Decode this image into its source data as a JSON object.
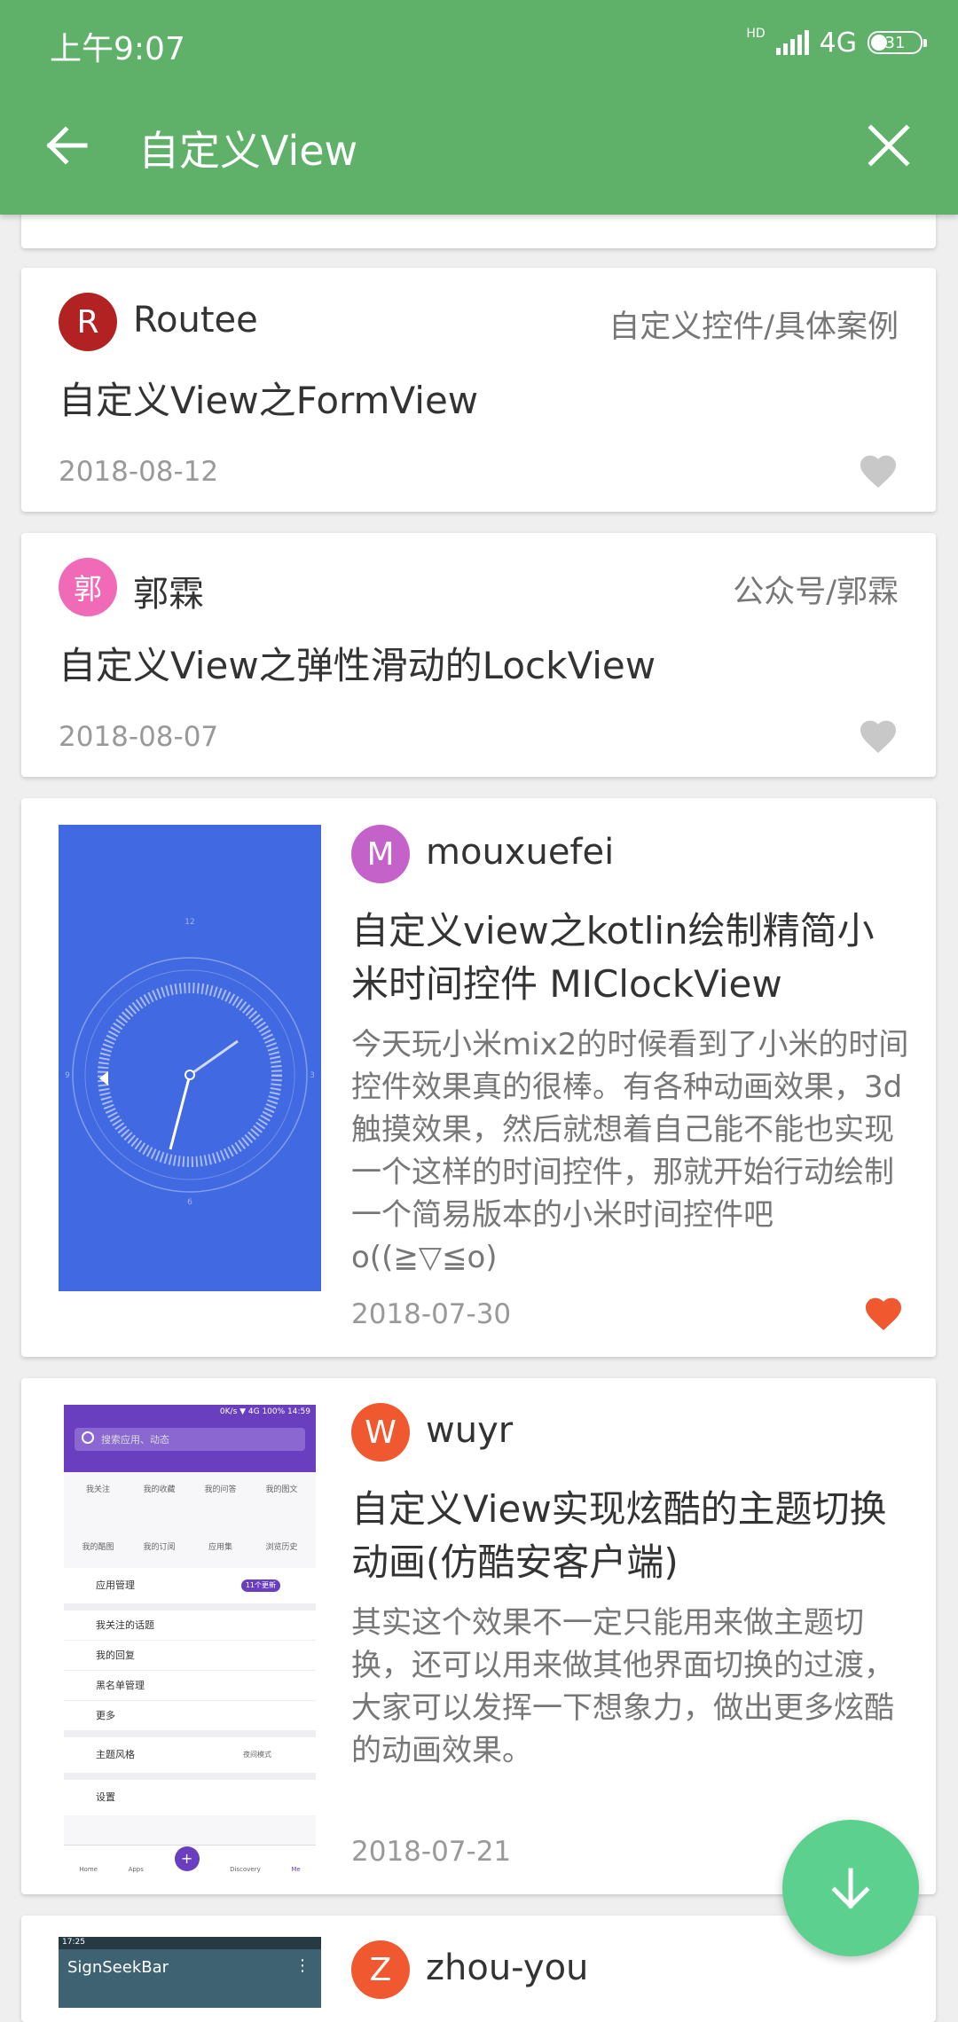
{
  "status_bar": {
    "time": "上午9:07",
    "hd": "HD",
    "network": "4G",
    "battery": "31"
  },
  "header": {
    "title": "自定义View"
  },
  "articles": [
    {
      "avatar_letter": "R",
      "avatar_color": "#b22222",
      "author": "Routee",
      "category": "自定义控件/具体案例",
      "title": "自定义View之FormView",
      "date": "2018-08-12",
      "liked": false
    },
    {
      "avatar_letter": "郭",
      "avatar_color": "#f06ab8",
      "author": "郭霖",
      "category": "公众号/郭霖",
      "title": "自定义View之弹性滑动的LockView",
      "date": "2018-08-07",
      "liked": false
    },
    {
      "avatar_letter": "M",
      "avatar_color": "#c462c9",
      "author": "mouxuefei",
      "title": "自定义view之kotlin绘制精简小米时间控件 MIClockView",
      "description": "今天玩小米mix2的时候看到了小米的时间控件效果真的很棒。有各种动画效果，3d触摸效果，然后就想着自己能不能也实现一个这样的时间控件，那就开始行动绘制一个简易版本的小米时间控件吧o((≧▽≦o)",
      "date": "2018-07-30",
      "liked": true,
      "thumbnail": {
        "clock_top": "12",
        "clock_bottom": "6",
        "clock_left": "9",
        "clock_right": "3"
      }
    },
    {
      "avatar_letter": "W",
      "avatar_color": "#f0582f",
      "author": "wuyr",
      "title": "自定义View实现炫酷的主题切换动画(仿酷安客户端)",
      "description": "其实这个效果不一定只能用来做主题切换，还可以用来做其他界面切换的过渡，大家可以发挥一下想象力，做出更多炫酷的动画效果。",
      "date": "2018-07-21",
      "liked": false,
      "thumbnail": {
        "status": "0K/s ▼ 4G 100% 14:59",
        "search_placeholder": "搜索应用、动态",
        "grid": [
          "我关注",
          "我的收藏",
          "我的问答",
          "我的图文",
          "我的酷图",
          "我的订阅",
          "应用集",
          "浏览历史"
        ],
        "menu": [
          "应用管理",
          "我关注的话题",
          "我的回复",
          "黑名单管理",
          "更多",
          "主题风格",
          "设置"
        ],
        "badge": "11个更新",
        "night_mode": "夜间模式",
        "nav": [
          "Home",
          "Apps",
          "+",
          "Discovery",
          "Me"
        ]
      }
    },
    {
      "avatar_letter": "Z",
      "avatar_color": "#f0582f",
      "author": "zhou-you",
      "thumbnail": {
        "time": "17:25",
        "title": "SignSeekBar",
        "menu": "⋮"
      }
    }
  ],
  "colors": {
    "primary": "#5fb169",
    "fab": "#5cd08e",
    "heart_on": "#f0582f",
    "heart_off": "#c8c8c8"
  },
  "icons": {
    "back": "arrow-left-icon",
    "close": "close-icon",
    "heart": "heart-icon",
    "fab": "arrow-down-icon"
  }
}
